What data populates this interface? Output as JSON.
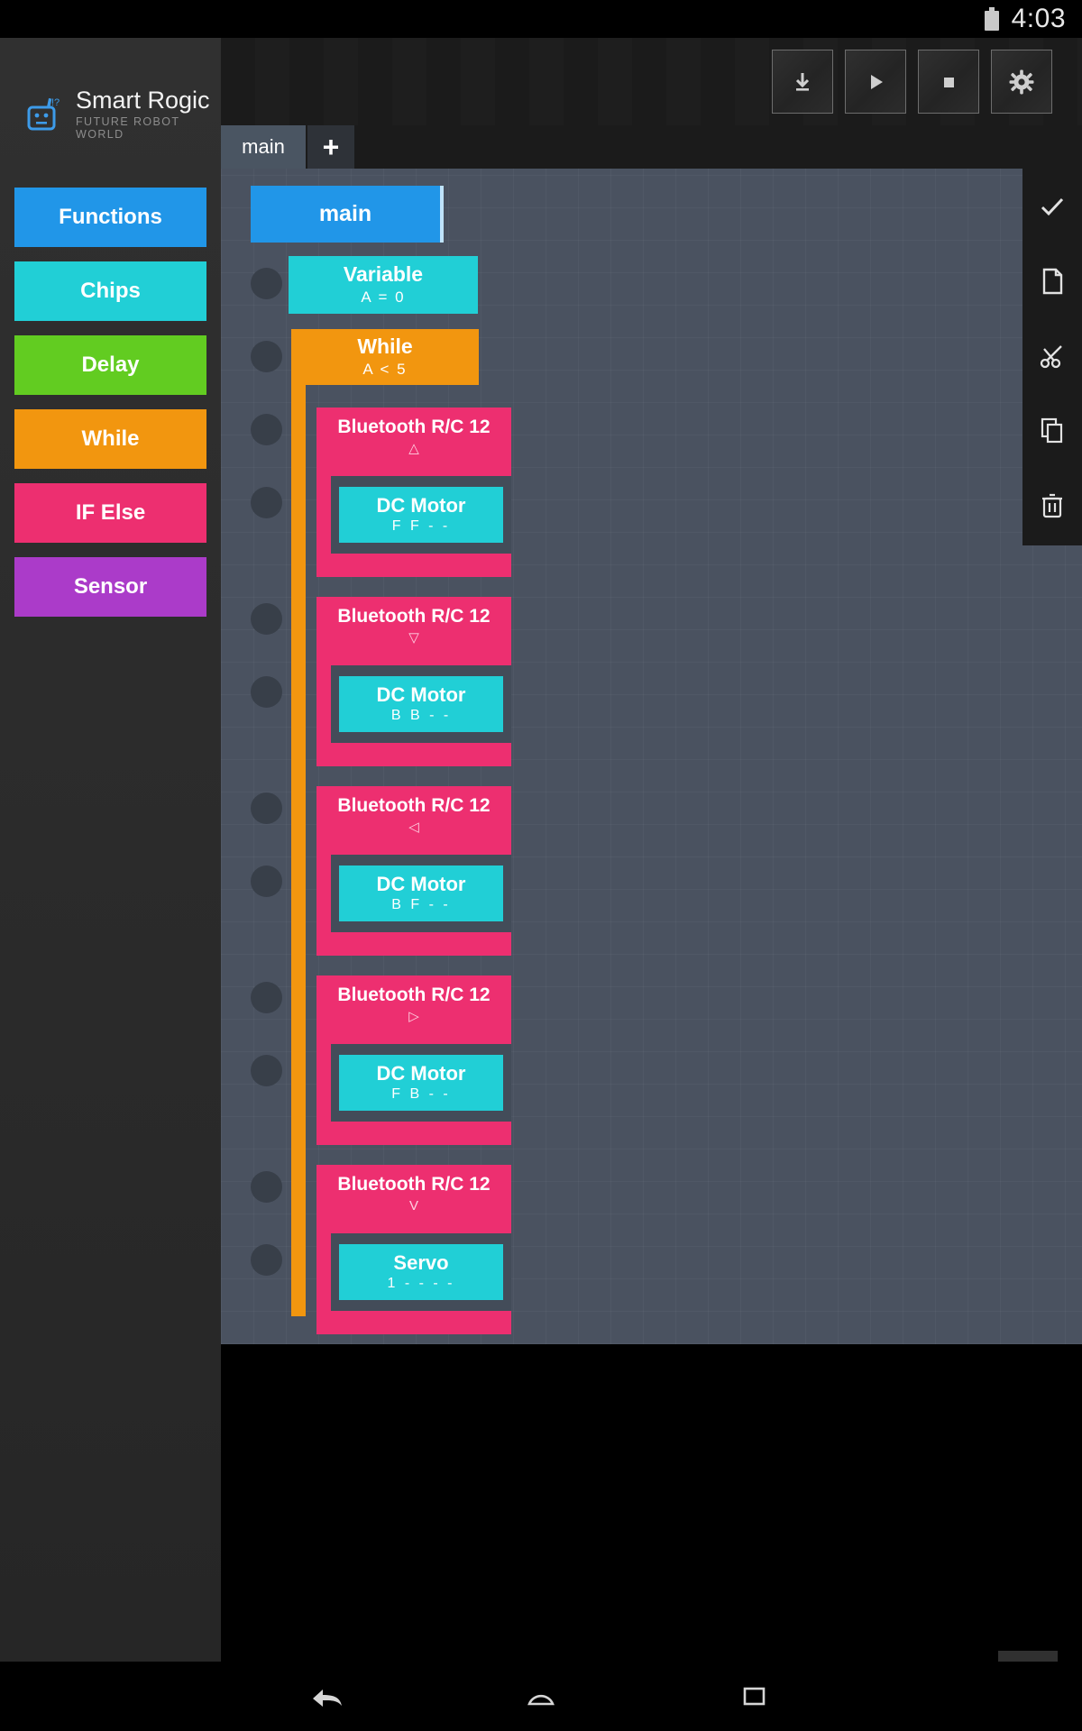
{
  "status_bar": {
    "time": "4:03",
    "battery_icon": "battery-icon"
  },
  "brand": {
    "title": "Smart Rogic",
    "subtitle": "FUTURE ROBOT WORLD",
    "logo_icon": "robot-logo"
  },
  "palette": {
    "items": [
      {
        "label": "Functions",
        "color": "#2196e8"
      },
      {
        "label": "Chips",
        "color": "#21cfd6"
      },
      {
        "label": "Delay",
        "color": "#62cc21"
      },
      {
        "label": "While",
        "color": "#f2960f"
      },
      {
        "label": "IF Else",
        "color": "#ed2f70"
      },
      {
        "label": "Sensor",
        "color": "#ab3bc9"
      }
    ]
  },
  "toolbar": {
    "buttons": [
      {
        "name": "download-button",
        "icon": "download-icon"
      },
      {
        "name": "run-button",
        "icon": "play-icon"
      },
      {
        "name": "stop-button",
        "icon": "stop-icon"
      },
      {
        "name": "settings-button",
        "icon": "gear-icon"
      }
    ]
  },
  "tabs": {
    "items": [
      {
        "label": "main",
        "active": true
      }
    ],
    "add_label": "+"
  },
  "right_rail": {
    "buttons": [
      {
        "name": "confirm-button",
        "icon": "check-icon"
      },
      {
        "name": "new-file-button",
        "icon": "file-icon"
      },
      {
        "name": "cut-button",
        "icon": "scissors-icon"
      },
      {
        "name": "copy-button",
        "icon": "copy-icon"
      },
      {
        "name": "delete-button",
        "icon": "trash-icon"
      }
    ],
    "fab": {
      "name": "trash-fab",
      "icon": "trash-icon"
    }
  },
  "navbar": {
    "buttons": [
      {
        "name": "back-button",
        "icon": "back-icon"
      },
      {
        "name": "home-button",
        "icon": "home-icon"
      },
      {
        "name": "recents-button",
        "icon": "recents-icon"
      }
    ]
  },
  "program": {
    "header": {
      "title": "main"
    },
    "variable": {
      "title": "Variable",
      "value": "A = 0"
    },
    "while": {
      "title": "While",
      "condition": "A  <  5"
    },
    "groups": [
      {
        "title": "Bluetooth R/C 12",
        "arrow": "△",
        "child": {
          "title": "DC Motor",
          "params": "F   F   -   -"
        }
      },
      {
        "title": "Bluetooth R/C 12",
        "arrow": "▽",
        "child": {
          "title": "DC Motor",
          "params": "B   B   -   -"
        }
      },
      {
        "title": "Bluetooth R/C 12",
        "arrow": "◁",
        "child": {
          "title": "DC Motor",
          "params": "B   F   -   -"
        }
      },
      {
        "title": "Bluetooth R/C 12",
        "arrow": "▷",
        "child": {
          "title": "DC Motor",
          "params": "F   B   -   -"
        }
      },
      {
        "title": "Bluetooth R/C 12",
        "arrow": "V",
        "child": {
          "title": "Servo",
          "params": "1   -   -   -   -"
        }
      }
    ]
  }
}
